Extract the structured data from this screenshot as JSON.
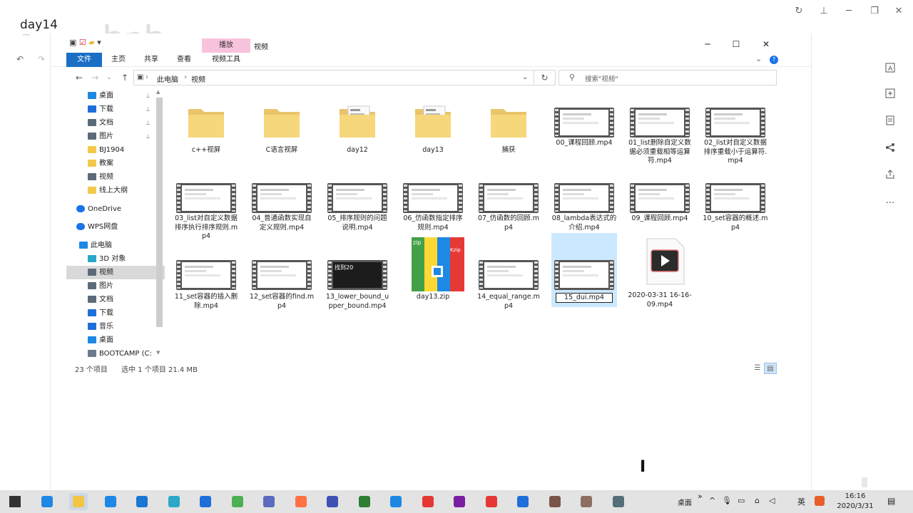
{
  "outer_title": "day14",
  "top_controls": [
    "refresh-icon",
    "pin-icon",
    "minimize-icon",
    "maximize-icon",
    "close-icon"
  ],
  "right_toolbar": [
    "translate-icon",
    "screenshot-icon",
    "notes-icon",
    "share-icon",
    "export-icon",
    "more-icon"
  ],
  "right_more": "···",
  "window": {
    "contextual_tab": "播放",
    "title": "视频",
    "minimize": "─",
    "maximize": "☐",
    "close": "✕"
  },
  "ribbon": {
    "tabs": [
      "文件",
      "主页",
      "共享",
      "查看",
      "视频工具"
    ],
    "help": "?"
  },
  "nav": {
    "back": "←",
    "forward": "→",
    "history": "⌄",
    "up": "↑",
    "crumbs": [
      "此电脑",
      "视频"
    ],
    "dropdown": "⌄",
    "refresh": "↻",
    "search_placeholder": "搜索\"视频\""
  },
  "sidebar": [
    {
      "label": "桌面",
      "icon": "desktop-icon",
      "color": "#1e88e5",
      "pinned": true
    },
    {
      "label": "下载",
      "icon": "download-icon",
      "color": "#1e6fd9",
      "pinned": true
    },
    {
      "label": "文档",
      "icon": "documents-icon",
      "color": "#5c6b7a",
      "pinned": true
    },
    {
      "label": "图片",
      "icon": "pictures-icon",
      "color": "#5c6b7a",
      "pinned": true
    },
    {
      "label": "BJ1904",
      "icon": "folder-icon",
      "color": "#f3c94c",
      "pinned": false
    },
    {
      "label": "教案",
      "icon": "folder-icon",
      "color": "#f3c94c",
      "pinned": false
    },
    {
      "label": "视频",
      "icon": "videos-icon",
      "color": "#5c6b7a",
      "pinned": false
    },
    {
      "label": "线上大纲",
      "icon": "folder-icon",
      "color": "#f3c94c",
      "pinned": false
    },
    {
      "label": "OneDrive",
      "icon": "onedrive-icon",
      "color": "#1a73e8",
      "pinned": false
    },
    {
      "label": "WPS网盘",
      "icon": "cloud-icon",
      "color": "#1a73e8",
      "pinned": false
    },
    {
      "label": "此电脑",
      "icon": "computer-icon",
      "color": "#1e88e5",
      "pinned": false
    },
    {
      "label": "3D 对象",
      "icon": "3d-objects-icon",
      "color": "#2aa7c9",
      "pinned": false
    },
    {
      "label": "视频",
      "icon": "videos-icon",
      "color": "#5c6b7a",
      "pinned": false,
      "selected": true
    },
    {
      "label": "图片",
      "icon": "pictures-icon",
      "color": "#5c6b7a",
      "pinned": false
    },
    {
      "label": "文档",
      "icon": "documents-icon",
      "color": "#5c6b7a",
      "pinned": false
    },
    {
      "label": "下载",
      "icon": "download-icon",
      "color": "#1e6fd9",
      "pinned": false
    },
    {
      "label": "音乐",
      "icon": "music-icon",
      "color": "#1e6fd9",
      "pinned": false
    },
    {
      "label": "桌面",
      "icon": "desktop-icon",
      "color": "#1e88e5",
      "pinned": false
    },
    {
      "label": "BOOTCAMP (C:",
      "icon": "drive-icon",
      "color": "#6b7b8c",
      "pinned": false
    }
  ],
  "pin_glyph": "📌",
  "files": [
    {
      "name": "c++视屏",
      "type": "folder"
    },
    {
      "name": "C语言视屏",
      "type": "folder"
    },
    {
      "name": "day12",
      "type": "folder"
    },
    {
      "name": "day13",
      "type": "folder"
    },
    {
      "name": "捕获",
      "type": "folder"
    },
    {
      "name": "00_课程回顾.mp4",
      "type": "video"
    },
    {
      "name": "01_list删除自定义数据必须重载相等运算符.mp4",
      "type": "video"
    },
    {
      "name": "02_list对自定义数据排序重载小于运算符.mp4",
      "type": "video"
    },
    {
      "name": "03_list对自定义数据排序执行排序规则.mp4",
      "type": "video"
    },
    {
      "name": "04_普通函数实现自定义规则.mp4",
      "type": "video"
    },
    {
      "name": "05_排序规则的问题说明.mp4",
      "type": "video"
    },
    {
      "name": "06_仿函数指定排序规则.mp4",
      "type": "video"
    },
    {
      "name": "07_仿函数的回顾.mp4",
      "type": "video"
    },
    {
      "name": "08_lambda表达式的介绍.mp4",
      "type": "video"
    },
    {
      "name": "09_课程回顾.mp4",
      "type": "video"
    },
    {
      "name": "10_set容器的概述.mp4",
      "type": "video"
    },
    {
      "name": "11_set容器的插入删除.mp4",
      "type": "video"
    },
    {
      "name": "12_set容器的find.mp4",
      "type": "video"
    },
    {
      "name": "13_lower_bound_upper_bound.mp4",
      "type": "video",
      "dark": true,
      "overlay": "找到20"
    },
    {
      "name": "day13.zip",
      "type": "zip"
    },
    {
      "name": "14_equal_range.mp4",
      "type": "video"
    },
    {
      "name": "15_dui.mp4",
      "type": "video",
      "selected": true,
      "renaming": true
    },
    {
      "name": "2020-03-31 16-16-09.mp4",
      "type": "media"
    }
  ],
  "zip_labels": {
    "left": "zip",
    "right": "Kzip"
  },
  "status": {
    "count": "23 个项目",
    "selection": "选中 1 个项目  21.4 MB"
  },
  "taskbar": {
    "apps": [
      "start-icon",
      "edge-icon",
      "file-explorer-icon",
      "store-icon",
      "mail-icon",
      "remote-icon",
      "teamviewer-icon",
      "wechat-work-icon",
      "powerpoint-icon",
      "firefox-icon",
      "feishu-icon",
      "wechat-icon",
      "wps-icon",
      "dictionary-icon",
      "visual-studio-icon",
      "netease-music-icon",
      "vmware-icon",
      "game-icon",
      "paint-icon",
      "terminal-icon"
    ],
    "tray_label": "桌面",
    "chevron": "»",
    "ime": "英",
    "time": "16:16",
    "date": "2020/3/31"
  }
}
